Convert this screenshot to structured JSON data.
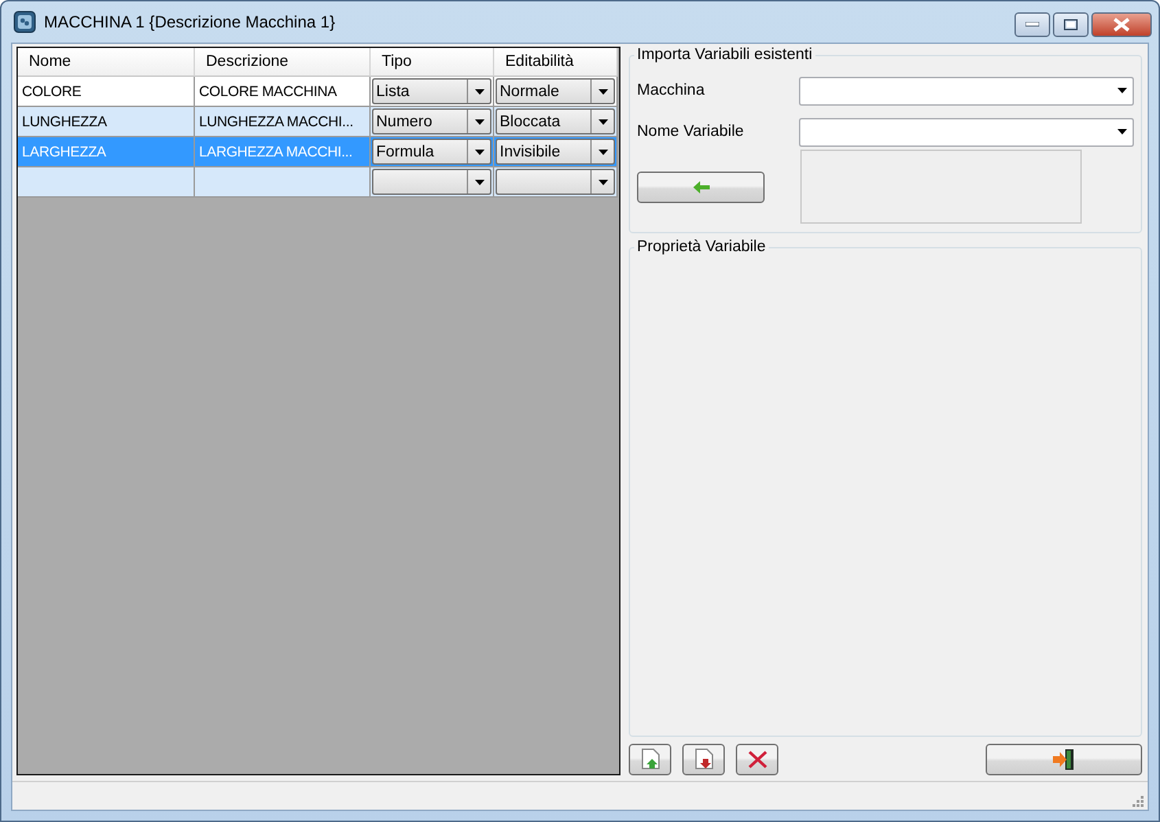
{
  "window": {
    "title": "MACCHINA 1 {Descrizione Macchina 1}"
  },
  "grid": {
    "columns": [
      "Nome",
      "Descrizione",
      "Tipo",
      "Editabilità"
    ],
    "rows": [
      {
        "nome": "COLORE",
        "descrizione": "COLORE MACCHINA",
        "tipo": "Lista",
        "editabilita": "Normale",
        "selected": false
      },
      {
        "nome": "LUNGHEZZA",
        "descrizione": "LUNGHEZZA MACCHI...",
        "tipo": "Numero",
        "editabilita": "Bloccata",
        "selected": false
      },
      {
        "nome": "LARGHEZZA",
        "descrizione": "LARGHEZZA MACCHI...",
        "tipo": "Formula",
        "editabilita": "Invisibile",
        "selected": true
      }
    ],
    "new_row": true
  },
  "import_group": {
    "title": "Importa Variabili esistenti",
    "fields": [
      {
        "label": "Macchina"
      },
      {
        "label": "Nome Variabile"
      }
    ]
  },
  "properties_group": {
    "title": "Proprietà Variabile"
  }
}
